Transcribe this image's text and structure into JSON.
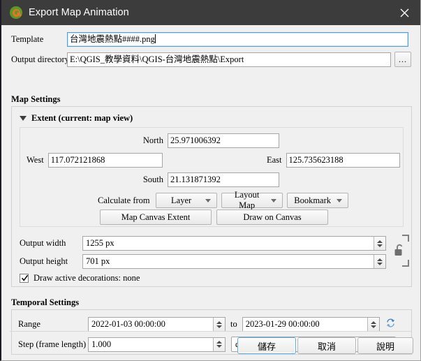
{
  "window": {
    "title": "Export Map Animation",
    "icon": "qgis-logo-icon",
    "close_label": "✕"
  },
  "top_fields": {
    "template_label": "Template",
    "template_value": "台灣地震熱點####.png",
    "output_dir_label": "Output directory",
    "output_dir_value": "E:\\QGIS_教學資料\\QGIS-台灣地震熱點\\Export",
    "browse_label": "…"
  },
  "map_settings": {
    "group_title": "Map Settings",
    "extent": {
      "header": "Extent (current: map view)",
      "expanded": true,
      "north_label": "North",
      "north_value": "25.971006392",
      "west_label": "West",
      "west_value": "117.072121868",
      "east_label": "East",
      "east_value": "125.735623188",
      "south_label": "South",
      "south_value": "21.131871392",
      "calculate_from_label": "Calculate from",
      "combo_layer": "Layer",
      "combo_layout_map": "Layout Map",
      "combo_bookmark": "Bookmark",
      "btn_map_canvas_extent": "Map Canvas Extent",
      "btn_draw_on_canvas": "Draw on Canvas"
    },
    "output_width_label": "Output width",
    "output_width_value": "1255 px",
    "output_height_label": "Output height",
    "output_height_value": "701 px",
    "lock_icon": "unlocked-padlock-icon",
    "decorations_label": "Draw active decorations: none",
    "decorations_checked": true
  },
  "temporal_settings": {
    "group_title": "Temporal Settings",
    "range_label": "Range",
    "range_start": "2022-01-03 00:00:00",
    "range_to_label": "to",
    "range_end": "2023-01-29 00:00:00",
    "refresh_icon": "refresh-icon",
    "step_label": "Step (frame length)",
    "step_value": "1.000",
    "step_unit": "days"
  },
  "buttons": {
    "save": "儲存",
    "cancel": "取消",
    "help": "說明"
  },
  "colors": {
    "titlebar_bg": "#3c3c3c",
    "dialog_bg": "#f0f0f0",
    "focus_blue": "#4d9fe0",
    "refresh_blue": "#3f7ec4",
    "qgis_green": "#5c9a23",
    "qgis_orange": "#e8732b"
  }
}
